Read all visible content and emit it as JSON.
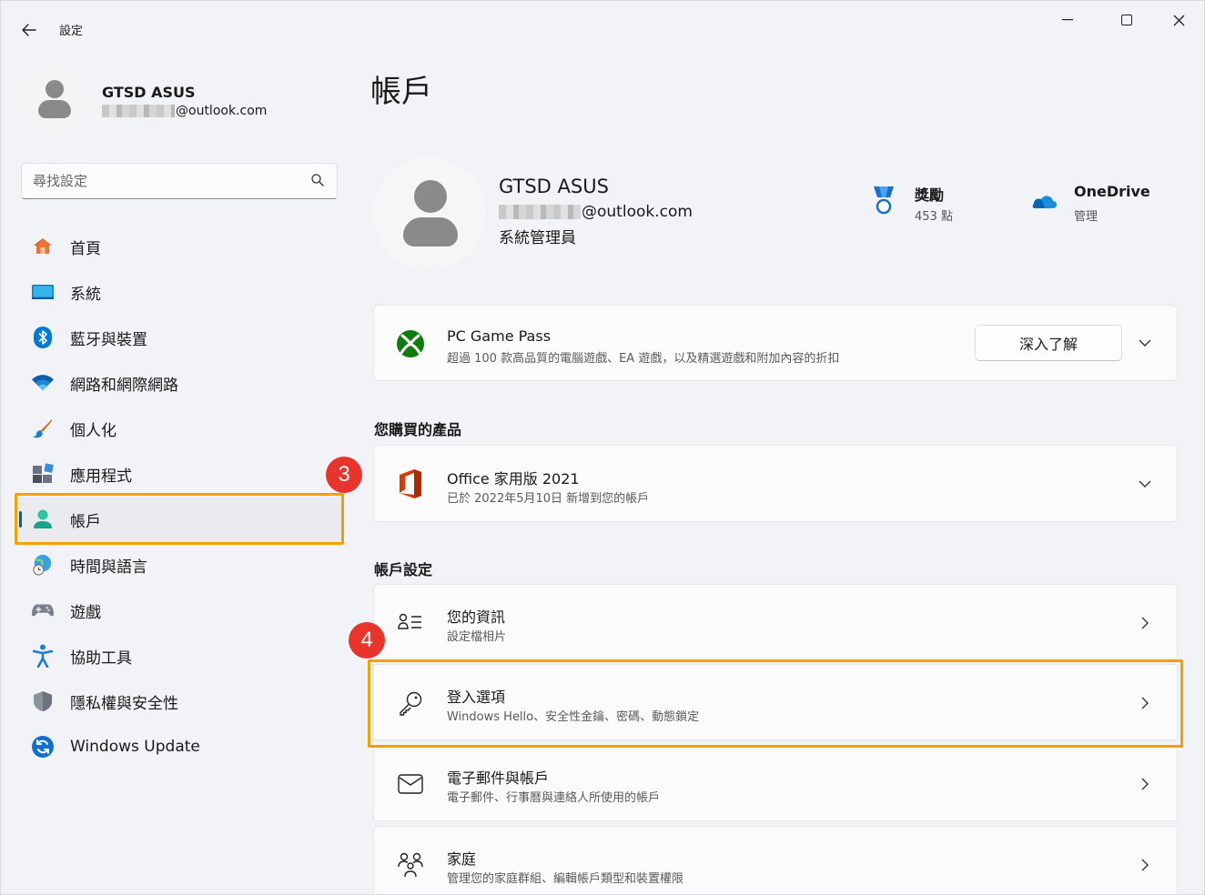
{
  "window": {
    "title": "設定",
    "back_icon": "back-arrow-icon",
    "controls": [
      "minimize",
      "maximize",
      "close"
    ]
  },
  "sidebar": {
    "profile": {
      "name": "GTSD ASUS",
      "email_suffix": "@outlook.com"
    },
    "search": {
      "placeholder": "尋找設定"
    },
    "items": [
      {
        "label": "首頁",
        "icon": "home-icon"
      },
      {
        "label": "系統",
        "icon": "system-icon"
      },
      {
        "label": "藍牙與裝置",
        "icon": "bluetooth-icon"
      },
      {
        "label": "網路和網際網路",
        "icon": "wifi-icon"
      },
      {
        "label": "個人化",
        "icon": "brush-icon"
      },
      {
        "label": "應用程式",
        "icon": "apps-icon"
      },
      {
        "label": "帳戶",
        "icon": "account-icon",
        "active": true
      },
      {
        "label": "時間與語言",
        "icon": "time-language-icon"
      },
      {
        "label": "遊戲",
        "icon": "gamepad-icon"
      },
      {
        "label": "協助工具",
        "icon": "accessibility-icon"
      },
      {
        "label": "隱私權與安全性",
        "icon": "shield-icon"
      },
      {
        "label": "Windows Update",
        "icon": "update-icon"
      }
    ]
  },
  "annotations": {
    "step3": "3",
    "step4": "4",
    "highlight_color": "#f4a100",
    "badge_color": "#e8342b"
  },
  "main": {
    "title": "帳戶",
    "account": {
      "name": "GTSD ASUS",
      "email_suffix": "@outlook.com",
      "role": "系統管理員"
    },
    "rewards": {
      "title": "獎勵",
      "value": "453 點"
    },
    "onedrive": {
      "title": "OneDrive",
      "subtitle": "管理"
    },
    "gamepass": {
      "title": "PC Game Pass",
      "subtitle": "超過 100 款高品質的電腦遊戲、EA 遊戲，以及精選遊戲和附加內容的折扣",
      "button": "深入了解"
    },
    "purchased_section": "您購買的產品",
    "office": {
      "title": "Office 家用版 2021",
      "subtitle": "已於 2022年5月10日 新增到您的帳戶"
    },
    "settings_section": "帳戶設定",
    "settings": [
      {
        "title": "您的資訊",
        "subtitle": "設定檔相片",
        "icon": "person-list-icon"
      },
      {
        "title": "登入選項",
        "subtitle": "Windows Hello、安全性金鑰、密碼、動態鎖定",
        "icon": "key-icon"
      },
      {
        "title": "電子郵件與帳戶",
        "subtitle": "電子郵件、行事曆與連絡人所使用的帳戶",
        "icon": "mail-icon"
      },
      {
        "title": "家庭",
        "subtitle": "管理您的家庭群組、編輯帳戶類型和裝置權限",
        "icon": "family-icon"
      }
    ],
    "accent_color": "#005fb8"
  }
}
